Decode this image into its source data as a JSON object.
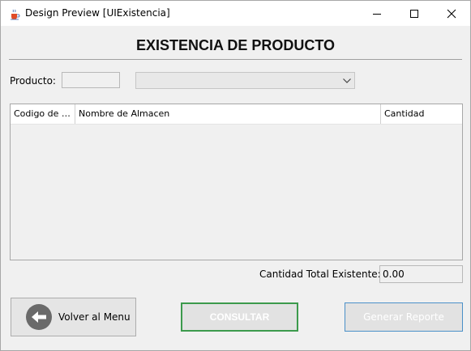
{
  "window": {
    "title": "Design Preview [UIExistencia]",
    "app_icon": "java-cup-icon",
    "controls": [
      "minimize-icon",
      "maximize-icon",
      "close-icon"
    ]
  },
  "heading": "EXISTENCIA DE PRODUCTO",
  "producto": {
    "label": "Producto:",
    "code_value": "",
    "combo_selected": ""
  },
  "table": {
    "columns": [
      "Codigo de Almacen",
      "Nombre de Almacen",
      "Cantidad"
    ],
    "columns_display": [
      "Codigo de A...",
      "Nombre de Almacen",
      "Cantidad"
    ],
    "rows": []
  },
  "total": {
    "label": "Cantidad  Total Existente:",
    "value": "0.00"
  },
  "buttons": {
    "volver": "Volver al Menu",
    "volver_icon": "back-arrow-icon",
    "consultar": "CONSULTAR",
    "generar": "Generar Reporte"
  },
  "colors": {
    "consultar_border": "#3c9a4c",
    "generar_border": "#4a90c8",
    "window_bg": "#f0f0f0"
  }
}
